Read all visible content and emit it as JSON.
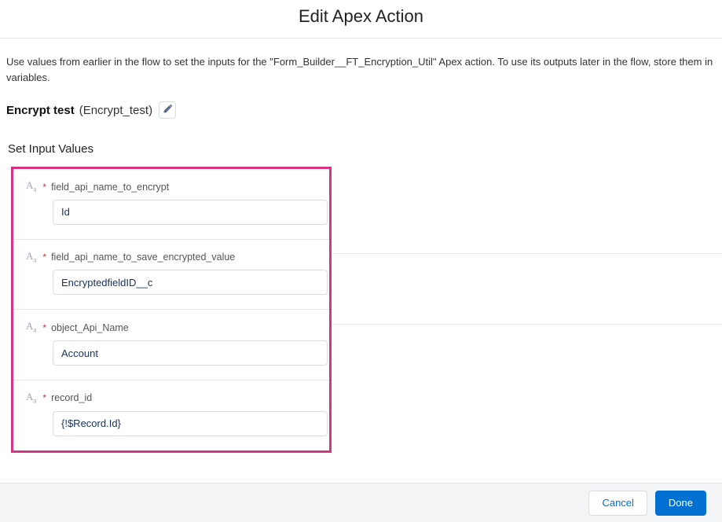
{
  "modal": {
    "title": "Edit Apex Action",
    "intro": "Use values from earlier in the flow to set the inputs for the \"Form_Builder__FT_Encryption_Util\" Apex action. To use its outputs later in the flow, store them in variables.",
    "action_label": "Encrypt test",
    "action_api": "(Encrypt_test)"
  },
  "section": {
    "heading": "Set Input Values"
  },
  "fields": [
    {
      "label": "field_api_name_to_encrypt",
      "value": "Id"
    },
    {
      "label": "field_api_name_to_save_encrypted_value",
      "value": "EncryptedfieldID__c"
    },
    {
      "label": "object_Api_Name",
      "value": "Account"
    },
    {
      "label": "record_id",
      "value": "{!$Record.Id}"
    }
  ],
  "footer": {
    "cancel": "Cancel",
    "done": "Done"
  }
}
